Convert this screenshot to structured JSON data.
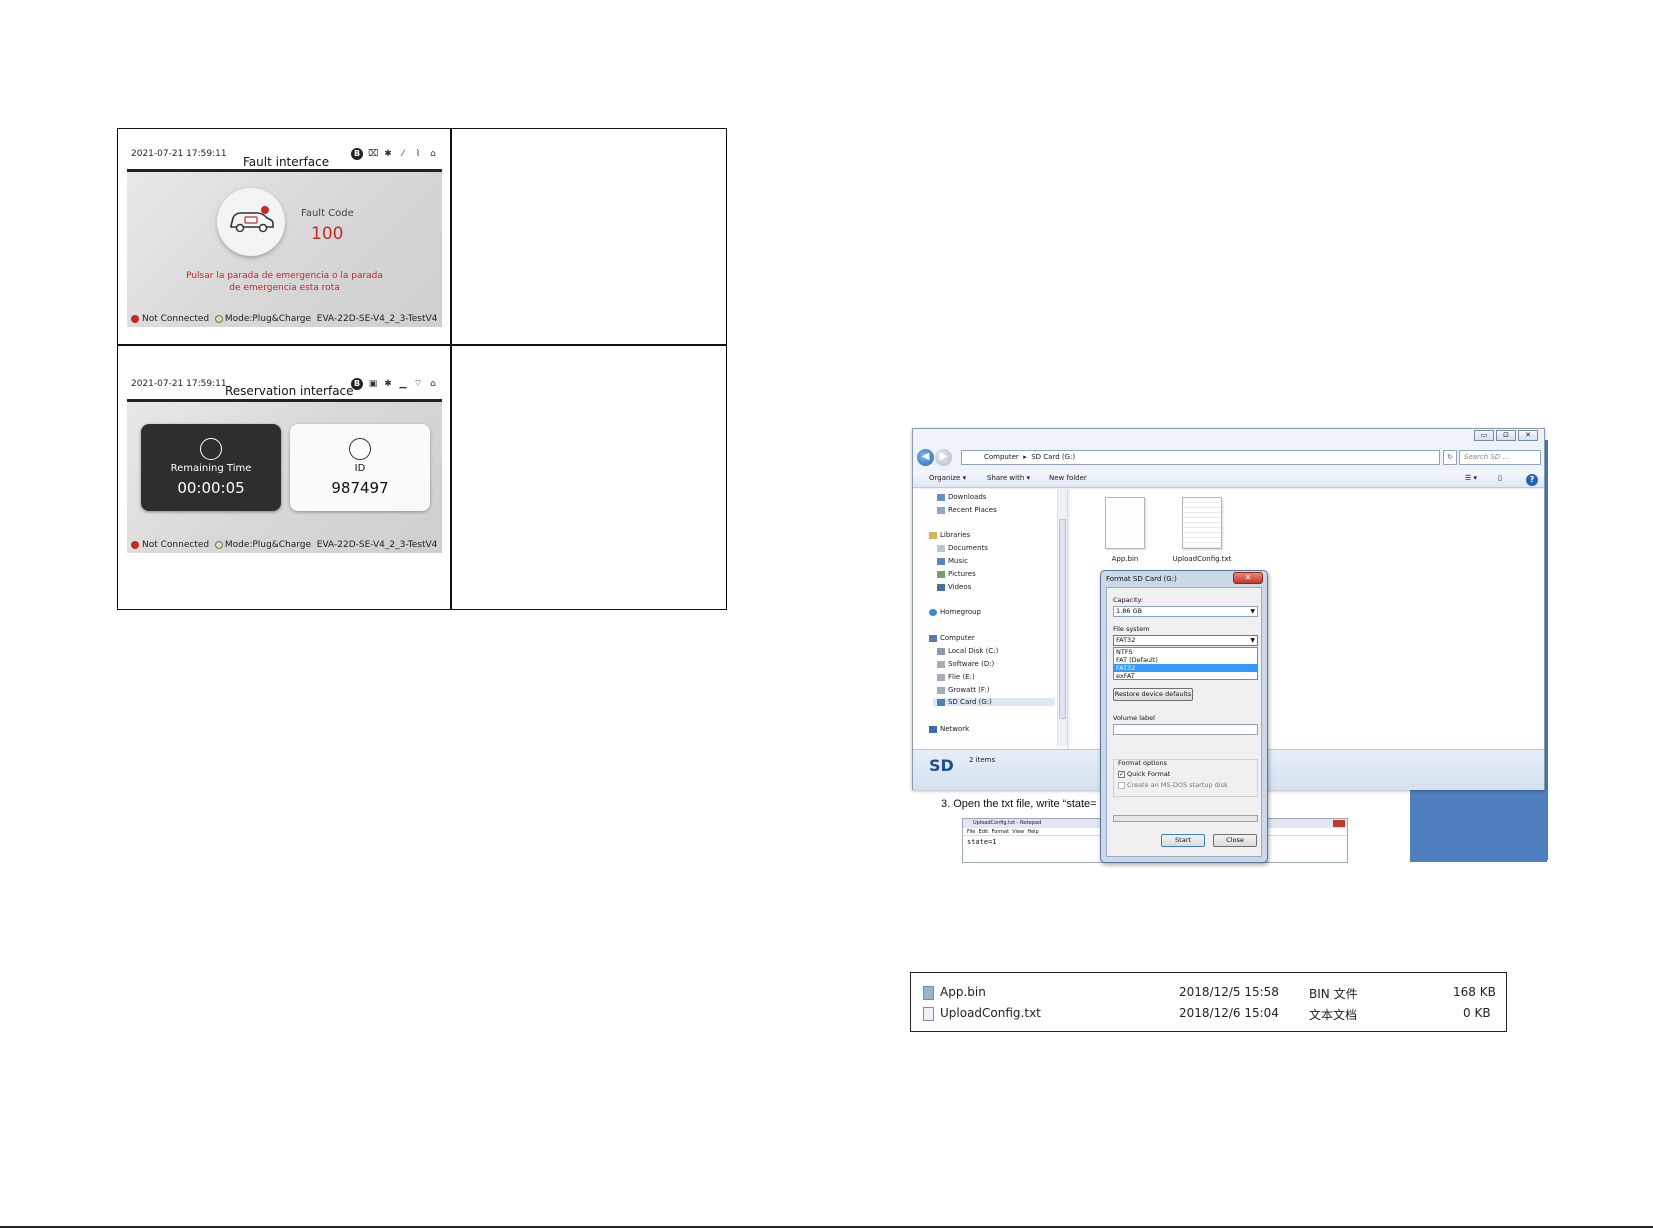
{
  "fault_screen": {
    "datetime": "2021-07-21  17:59:11",
    "title": "Fault interface",
    "fault_code_label": "Fault Code",
    "fault_code": "100",
    "message_line1": "Pulsar la parada de emergencia o la parada",
    "message_line2": "de emergencia esta rota",
    "status_connection": "Not Connected",
    "status_mode": "Mode:Plug&Charge",
    "status_version": "EVA-22D-SE-V4_2_3-TestV4",
    "bluetooth_badge": "B"
  },
  "reservation_screen": {
    "datetime": "2021-07-21  17:59:11",
    "title": "Reservation interface",
    "remaining_label": "Remaining Time",
    "remaining_value": "00:00:05",
    "id_label": "ID",
    "id_value": "987497",
    "status_connection": "Not Connected",
    "status_mode": "Mode:Plug&Charge",
    "status_version": "EVA-22D-SE-V4_2_3-TestV4",
    "bluetooth_badge": "B"
  },
  "explorer": {
    "path": [
      "Computer",
      "SD Card (G:)"
    ],
    "search_placeholder": "Search SD ...",
    "toolbar": {
      "organize": "Organize ▾",
      "share": "Share with ▾",
      "new_folder": "New folder"
    },
    "nav": {
      "downloads": "Downloads",
      "recent": "Recent Places",
      "libraries": "Libraries",
      "documents": "Documents",
      "music": "Music",
      "pictures": "Pictures",
      "videos": "Videos",
      "homegroup": "Homegroup",
      "computer": "Computer",
      "disk_c": "Local Disk (C:)",
      "disk_d": "Software (D:)",
      "disk_e": "Flie (E:)",
      "disk_f": "Growatt (F:)",
      "disk_g": "SD Card (G:)",
      "network": "Network"
    },
    "files": [
      {
        "name": "App.bin"
      },
      {
        "name": "UploadConfig.txt"
      }
    ],
    "status_logo": "SD",
    "status_count": "2 items",
    "window_controls": [
      "▭",
      "⊡",
      "✕"
    ]
  },
  "format_dialog": {
    "title": "Format SD Card (G:)",
    "capacity_label": "Capacity:",
    "capacity_value": "1.86 GB",
    "fs_label": "File system",
    "fs_value": "FAT32",
    "fs_options": [
      "NTFS",
      "FAT (Default)",
      "FAT32",
      "exFAT"
    ],
    "fs_selected_index": 2,
    "restore_button": "Restore device defaults",
    "volume_label": "Volume label",
    "volume_value": "",
    "format_options_label": "Format options",
    "quick_format": "Quick Format",
    "quick_format_checked": true,
    "msdos_disk": "Create an MS-DOS startup disk",
    "start_button": "Start",
    "close_button": "Close",
    "close_glyph": "✕"
  },
  "step3": {
    "text": "3.   Open the txt file, write “state="
  },
  "notepad": {
    "title": "UploadConfig.txt - Notepad",
    "menu": [
      "File",
      "Edit",
      "Format",
      "View",
      "Help"
    ],
    "content": "state=1"
  },
  "file_list": [
    {
      "name": "App.bin",
      "date": "2018/12/5 15:58",
      "type": "BIN 文件",
      "size": "168 KB"
    },
    {
      "name": "UploadConfig.txt",
      "date": "2018/12/6 15:04",
      "type": "文本文档",
      "size": "0 KB"
    }
  ],
  "colors": {
    "fault_red": "#c62828",
    "win_blue": "#2a65b5",
    "selection": "#3399ff"
  }
}
